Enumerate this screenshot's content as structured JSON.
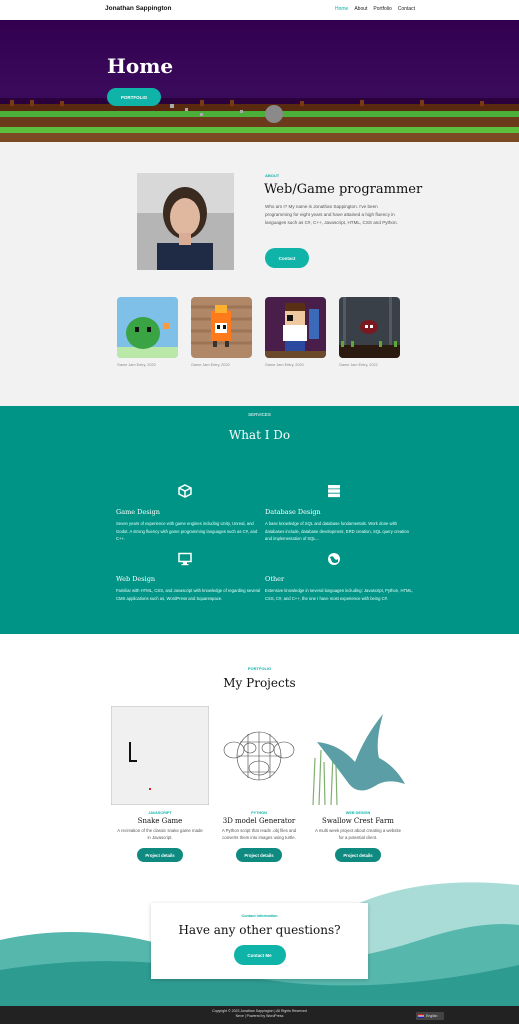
{
  "header": {
    "site_title": "Jonathan Sappington",
    "nav": [
      {
        "label": "Home",
        "active": true
      },
      {
        "label": "About",
        "active": false
      },
      {
        "label": "Portfolio",
        "active": false
      },
      {
        "label": "Contact",
        "active": false
      }
    ]
  },
  "hero": {
    "title": "Home",
    "button_label": "PORTFOLIO"
  },
  "about": {
    "kicker": "ABOUT",
    "heading": "Web/Game programmer",
    "text": "Who am I? My name is Jonathan Sappington. I've been programming for eight years and have attained a high fluency in languages such as C#, C++, Javascript, HTML, CSS and Python.",
    "button_label": "Contact",
    "gallery": [
      {
        "caption": "Game Jam Entry, 2020",
        "icon": "green-blob-sprite"
      },
      {
        "caption": "Game Jam Entry, 2020",
        "icon": "fire-sprite"
      },
      {
        "caption": "Game Jam Entry, 2020",
        "icon": "pixel-character-sprite"
      },
      {
        "caption": "Game Jam Entry, 2022",
        "icon": "forest-scene-sprite"
      }
    ]
  },
  "services": {
    "kicker": "SERVICES",
    "title": "What I Do",
    "items": [
      {
        "title": "Game Design",
        "icon": "cube-icon",
        "text": "Seven years of experience with game engines including Unity, Unreal, and Godot. A strong fluency with game programming languages such as C#, and C++."
      },
      {
        "title": "Database Design",
        "icon": "database-icon",
        "text": "A base knowledge of SQL and database fundamentals. Work done with databases include, database development, ERD creation, SQL query creation and implementation of SQL..."
      },
      {
        "title": "Web Design",
        "icon": "monitor-icon",
        "text": "Familiar with HTML, CSS, and Javascript with knowledge of regarding several CMS applications such as, WordPress and Squarespace."
      },
      {
        "title": "Other",
        "icon": "globe-icon",
        "text": "Extensive knowledge in several languages including: Javascript, Python, HTML, CSS, C#, and C++, the one I have most experience with being C#."
      }
    ]
  },
  "projects": {
    "kicker": "PORTFOLIO",
    "title": "My Projects",
    "items": [
      {
        "category": "JAVASCRIPT",
        "name": "Snake Game",
        "desc": "A recreation of the classic snake game made in Javascript.",
        "button": "Project details"
      },
      {
        "category": "PYTHON",
        "name": "3D model Generator",
        "desc": "A Python script that reads .obj files and converts them into images using turtle.",
        "button": "Project details"
      },
      {
        "category": "WEB DESIGN",
        "name": "Swallow Crest Farm",
        "desc": "A multi week project about creating a website for a potential client.",
        "button": "Project details"
      }
    ]
  },
  "contact": {
    "kicker": "Contact Information",
    "title": "Have any other questions?",
    "button_label": "Contact Me"
  },
  "footer": {
    "copyright": "Copyright © 2023 Jonathan Sappington | All Rights Reserved",
    "powered": "Neve | Powered by WordPress",
    "language": "English"
  },
  "colors": {
    "accent": "#10b3a7",
    "services_bg": "#009486",
    "hero_bg": "#33004f",
    "footer_bg": "#222222"
  }
}
